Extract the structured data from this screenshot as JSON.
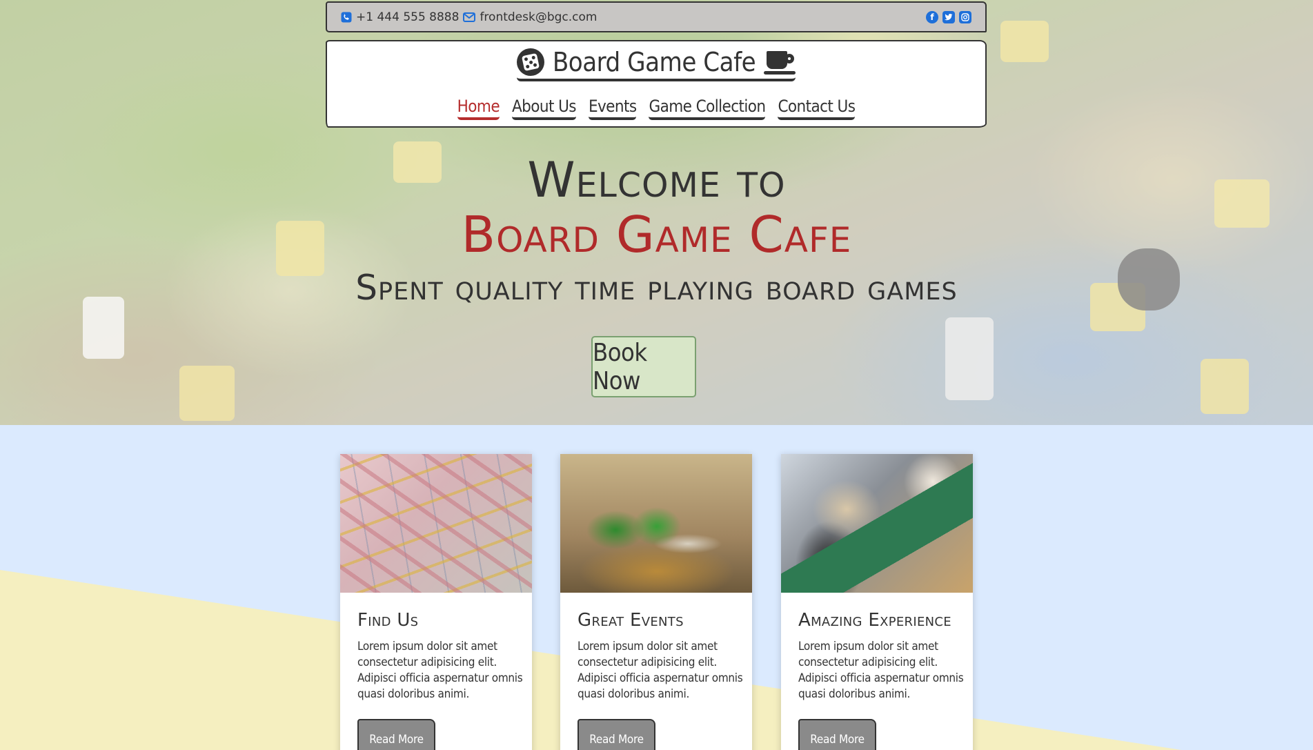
{
  "contact": {
    "phone": "+1 444 555 8888",
    "email": "frontdesk@bgc.com",
    "social": [
      "facebook-icon",
      "twitter-icon",
      "instagram-icon"
    ]
  },
  "brand": {
    "title": "Board Game Cafe"
  },
  "nav": {
    "items": [
      {
        "label": "Home",
        "active": true
      },
      {
        "label": "About Us",
        "active": false
      },
      {
        "label": "Events",
        "active": false
      },
      {
        "label": "Game Collection",
        "active": false
      },
      {
        "label": "Contact Us",
        "active": false
      }
    ]
  },
  "hero": {
    "welcome": "Welcome to",
    "cafe": "Board Game Cafe",
    "subtitle": "Spent quality time playing board games",
    "cta": "Book Now"
  },
  "cards": [
    {
      "title": "Find Us",
      "text": "Lorem ipsum dolor sit amet consectetur adipisicing elit. Adipisci officia aspernatur omnis quasi doloribus animi.",
      "button": "Read More"
    },
    {
      "title": "Great Events",
      "text": "Lorem ipsum dolor sit amet consectetur adipisicing elit. Adipisci officia aspernatur omnis quasi doloribus animi.",
      "button": "Read More"
    },
    {
      "title": "Amazing Experience",
      "text": "Lorem ipsum dolor sit amet consectetur adipisicing elit. Adipisci officia aspernatur omnis quasi doloribus animi.",
      "button": "Read More"
    }
  ],
  "colors": {
    "accent_red": "#b52d2d",
    "icon_blue": "#1e6fd9",
    "cta_green": "#d8e6c8",
    "section_blue": "#dbeafe",
    "section_yellow": "#f5efc0"
  }
}
